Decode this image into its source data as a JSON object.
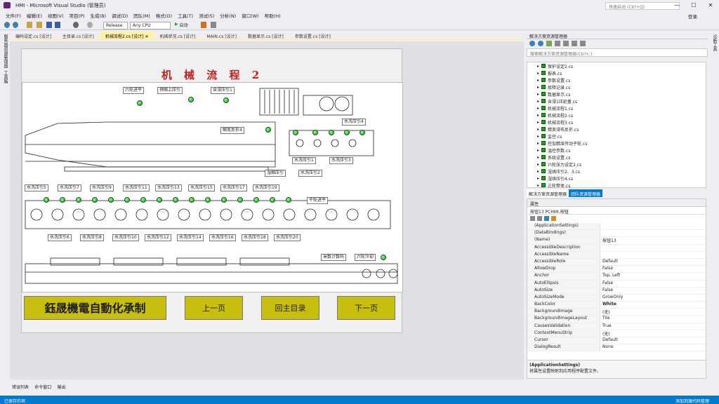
{
  "window": {
    "title": "HMI - Microsoft Visual Studio (管理员)",
    "quick_launch": "快速启动 (Ctrl+Q)",
    "login": "登录"
  },
  "menu": [
    "文件(F)",
    "编辑(E)",
    "视图(V)",
    "项目(P)",
    "生成(B)",
    "调试(D)",
    "团队(M)",
    "格式(O)",
    "工具(T)",
    "测试(S)",
    "分析(N)",
    "窗口(W)",
    "帮助(H)"
  ],
  "toolbar": {
    "config": "Release",
    "platform": "Any CPU",
    "start": "启动"
  },
  "left_dock": [
    "服务器资源管理器",
    "工具箱"
  ],
  "right_dock": [
    "诊断工具"
  ],
  "tabs": [
    {
      "label": "编码设定.cs [设计]"
    },
    {
      "label": "主目录.cs [设计]"
    },
    {
      "label": "机械流程2.cs [设计]",
      "active": true
    },
    {
      "label": "机械状况.cs [设计]"
    },
    {
      "label": "MAIN.cs [设计]"
    },
    {
      "label": "数据显示.cs [设计]"
    },
    {
      "label": "参数设置.cs [设计]"
    }
  ],
  "form": {
    "title": "机 械 流 程 2",
    "labels": {
      "l1": "六轮进平",
      "l2": "预缩上压引",
      "l3": "含浸压引1",
      "l4": "缩宽反折4",
      "l5": "水洗压引4",
      "l6": "水洗压引1",
      "l7": "水洗压引3",
      "l8": "湿缩压引",
      "l9": "水洗压引2",
      "r1": "水洗压引5",
      "r2": "水洗压引7",
      "r3": "水洗压引9",
      "r4": "水洗压引11",
      "r5": "水洗压引13",
      "r6": "水洗压引15",
      "r7": "水洗压引17",
      "r8": "水洗压引19",
      "r9": "干轮进平",
      "b1": "水洗压引6",
      "b2": "水洗压引8",
      "b3": "水洗压引10",
      "b4": "水洗压引12",
      "b5": "水洗压引14",
      "b6": "水洗压引16",
      "b7": "水洗压引18",
      "b8": "水洗压引20",
      "c1": "米数计数码",
      "c2": "六轮冷却"
    },
    "company": "鈺晟機電自動化承制",
    "prev": "上一页",
    "home": "回主目录",
    "next": "下一页"
  },
  "output_tabs": [
    "错误列表",
    "命令窗口",
    "输出"
  ],
  "status": {
    "left": "已保存的项",
    "right": "添加到源代码管理"
  },
  "solution_explorer": {
    "title": "解决方案资源管理器",
    "search": "搜索解决方案资源管理器(Ctrl+;)",
    "items": [
      "保护设定2.cs",
      "报表.cs",
      "参数设置.cs",
      "故障记录.cs",
      "数据显示.cs",
      "含浸1压延量.cs",
      "机械流程1.cs",
      "机械流程2.cs",
      "机械流程3.cs",
      "精英浸布反折.cs",
      "监控.cs",
      "控加精准传动子轮.cs",
      "温控参数.cs",
      "系统设置.cs",
      "六轮张力设定2.cs",
      "湿烘压引2、3.cs",
      "湿烘压引4.cs",
      "三轮整体.cs"
    ],
    "bottom_tabs": [
      "解决方案资源管理器",
      "团队资源管理器"
    ]
  },
  "properties": {
    "title": "属性",
    "object": "按钮13 PCHMI.按钮",
    "rows": [
      {
        "name": "(ApplicationSettings)",
        "value": ""
      },
      {
        "name": "(DataBindings)",
        "value": ""
      },
      {
        "name": "(Name)",
        "value": "按钮13"
      },
      {
        "name": "AccessibleDescription",
        "value": ""
      },
      {
        "name": "AccessibleName",
        "value": ""
      },
      {
        "name": "AccessibleRole",
        "value": "Default"
      },
      {
        "name": "AllowDrop",
        "value": "False"
      },
      {
        "name": "Anchor",
        "value": "Top, Left"
      },
      {
        "name": "AutoEllipsis",
        "value": "False"
      },
      {
        "name": "AutoSize",
        "value": "False"
      },
      {
        "name": "AutoSizeMode",
        "value": "GrowOnly"
      },
      {
        "name": "BackColor",
        "value": "White"
      },
      {
        "name": "BackgroundImage",
        "value": "(无)"
      },
      {
        "name": "BackgroundImageLayout",
        "value": "Tile"
      },
      {
        "name": "CausesValidation",
        "value": "True"
      },
      {
        "name": "ContextMenuStrip",
        "value": "(无)"
      },
      {
        "name": "Cursor",
        "value": "Default"
      },
      {
        "name": "DialogResult",
        "value": "None"
      }
    ],
    "desc_title": "(ApplicationSettings)",
    "desc": "将属性设置映射到应用程序配置文件。"
  },
  "colors": {
    "accent": "#007acc",
    "title_red": "#c02020",
    "button_yellow": "#c8be0f",
    "led_green": "#1a9a1a"
  }
}
